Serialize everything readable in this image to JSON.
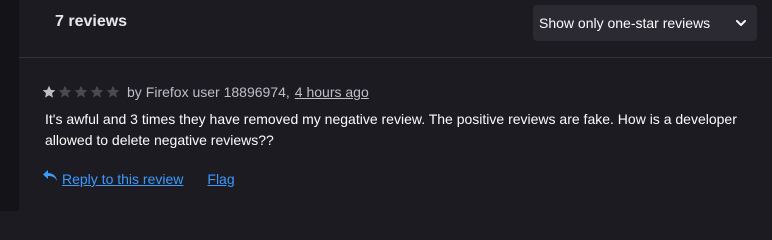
{
  "header": {
    "title": "7 reviews",
    "filter_selected": "Show only one-star reviews"
  },
  "review": {
    "rating": 1,
    "rating_max": 5,
    "author_prefix": "by",
    "author": "Firefox user 18896974,",
    "timestamp": "4 hours ago",
    "body": "It's awful and 3 times they have removed my negative review. The positive reviews are fake. How is a developer allowed to delete negative reviews??",
    "reply_label": "Reply to this review",
    "flag_label": "Flag"
  },
  "colors": {
    "background": "#1c1b22",
    "select_background": "#2b2a33",
    "link": "#3a9bff",
    "star_filled": "#bfbfc9",
    "star_empty": "#4a4950"
  },
  "icons": {
    "star": "star-icon",
    "chevron": "chevron-down-icon",
    "reply": "reply-icon"
  }
}
